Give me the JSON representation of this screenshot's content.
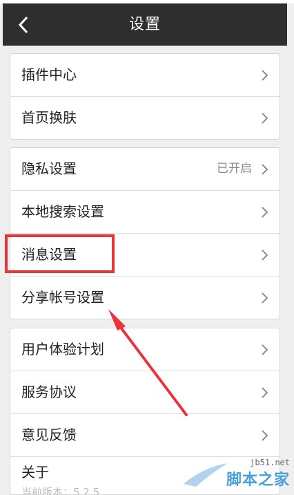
{
  "header": {
    "title": "设置"
  },
  "groups": [
    {
      "items": [
        {
          "label": "插件中心"
        },
        {
          "label": "首页换肤"
        }
      ]
    },
    {
      "items": [
        {
          "label": "隐私设置",
          "value": "已开启"
        },
        {
          "label": "本地搜索设置"
        },
        {
          "label": "消息设置"
        },
        {
          "label": "分享帐号设置"
        }
      ]
    },
    {
      "items": [
        {
          "label": "用户体验计划"
        },
        {
          "label": "服务协议"
        },
        {
          "label": "意见反馈"
        },
        {
          "label": "关于",
          "sub": "当前版本：5.2.5"
        }
      ]
    }
  ],
  "watermark": {
    "url": "jb51.net",
    "name": "脚本之家"
  },
  "colors": {
    "header_bg": "#2e2e2e",
    "highlight": "#e8343a",
    "watermark": "#4a9ed8"
  },
  "icons": {
    "back": "chevron-left-icon",
    "row_arrow": "chevron-right-icon"
  }
}
